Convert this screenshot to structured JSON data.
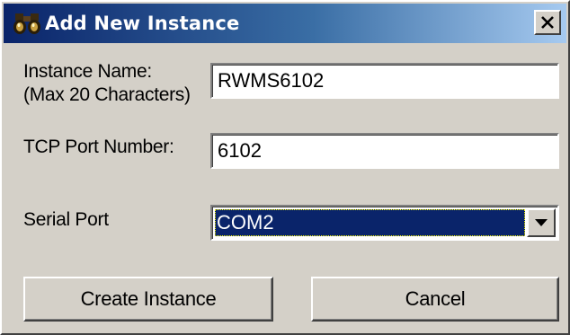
{
  "window": {
    "title": "Add New Instance",
    "icon": "binoculars-icon",
    "close_label": "×"
  },
  "form": {
    "instance_name": {
      "label_line1": "Instance Name:",
      "label_line2": "(Max 20 Characters)",
      "value": "RWMS6102"
    },
    "tcp_port": {
      "label": "TCP Port Number:",
      "value": "6102"
    },
    "serial_port": {
      "label": "Serial Port",
      "selected": "COM2"
    }
  },
  "buttons": {
    "create_label": "Create Instance",
    "cancel_label": "Cancel"
  },
  "colors": {
    "title_gradient_start": "#0a246a",
    "title_gradient_end": "#a6caf0",
    "selection": "#0a246a",
    "face": "#d4d0c8"
  }
}
